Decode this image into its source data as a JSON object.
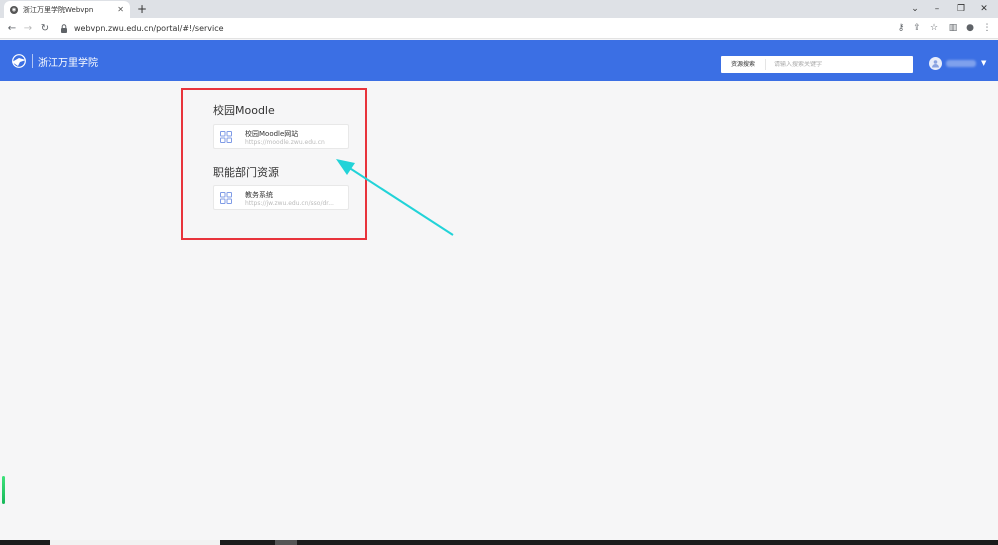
{
  "browser": {
    "tab_title": "浙江万里学院Webvpn",
    "tab_close": "✕",
    "new_tab": "+",
    "url": "webvpn.zwu.edu.cn/portal/#!/service"
  },
  "header": {
    "school_name": "浙江万里学院",
    "search_label": "资源搜索",
    "search_placeholder": "请输入搜索关键字",
    "brand_color": "#3b6fe4"
  },
  "sections": [
    {
      "title": "校园Moodle",
      "cards": [
        {
          "title": "校园Moodle网站",
          "url": "https://moodle.zwu.edu.cn"
        }
      ]
    },
    {
      "title": "职能部门资源",
      "cards": [
        {
          "title": "教务系统",
          "url": "https://jw.zwu.edu.cn/sso/dr..."
        }
      ]
    }
  ],
  "annotation": {
    "box_color": "#e8333b",
    "arrow_color": "#22d3d8"
  },
  "icons": {
    "tab_favicon": "globe-icon",
    "back": "arrow-left-icon",
    "forward": "arrow-right-icon",
    "reload": "reload-icon",
    "lock": "lock-icon",
    "key": "key-icon",
    "share": "share-icon",
    "bookmark": "star-icon",
    "sidepanel": "sidepanel-icon",
    "profile": "profile-icon",
    "menu": "kebab-menu-icon",
    "app": "app-grid-icon"
  }
}
